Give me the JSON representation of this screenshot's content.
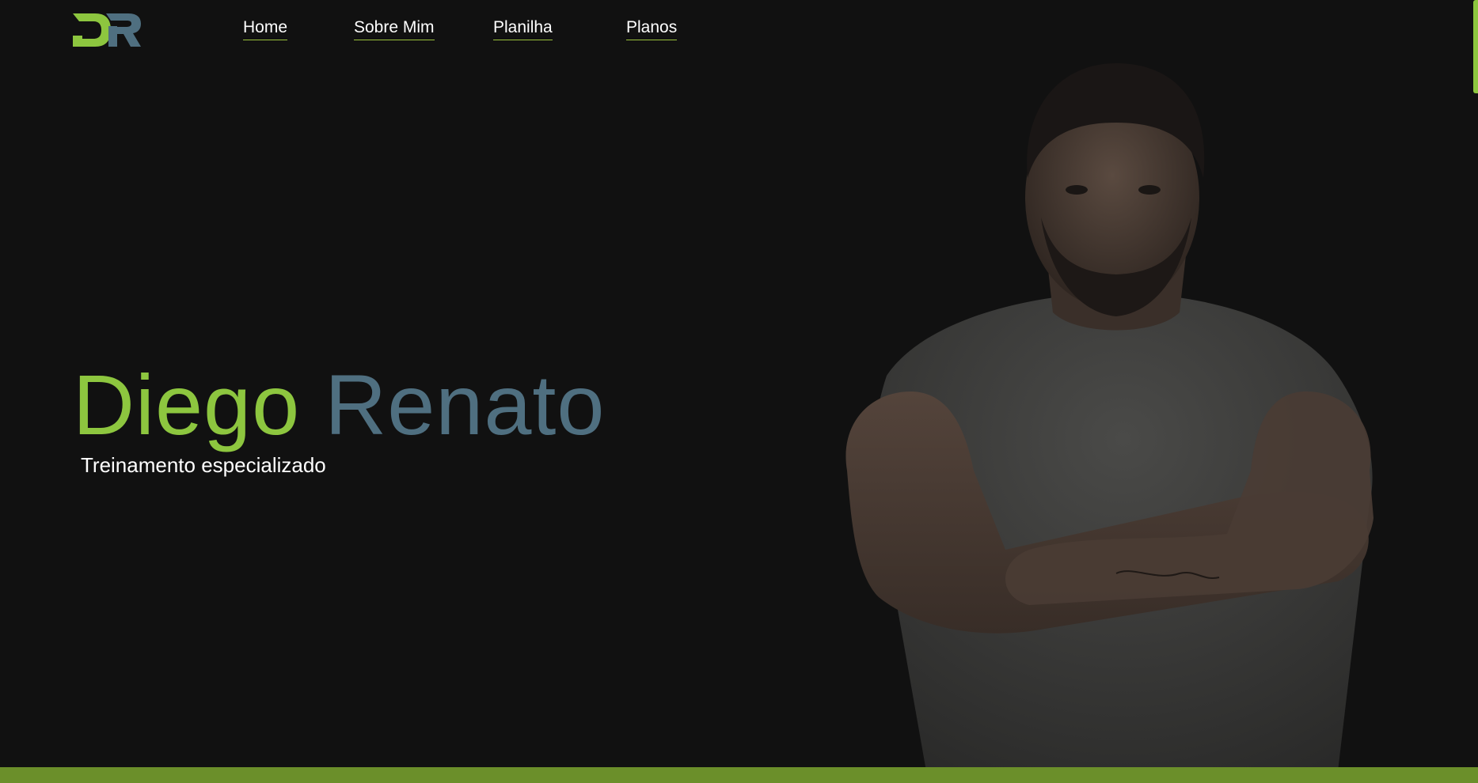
{
  "brand": {
    "logo_icon": "dr-logo-icon",
    "accent_color": "#8dc63f",
    "secondary_color": "#4f6f80"
  },
  "nav": {
    "items": [
      {
        "label": "Home"
      },
      {
        "label": "Sobre Mim"
      },
      {
        "label": "Planilha"
      },
      {
        "label": "Planos"
      }
    ]
  },
  "hero": {
    "first_name": "Diego",
    "last_name": "Renato",
    "subtitle": "Treinamento especializado",
    "photo_icon": "trainer-portrait-photo"
  },
  "colors": {
    "background": "#111111",
    "bottom_bar": "#6b8f2a"
  }
}
